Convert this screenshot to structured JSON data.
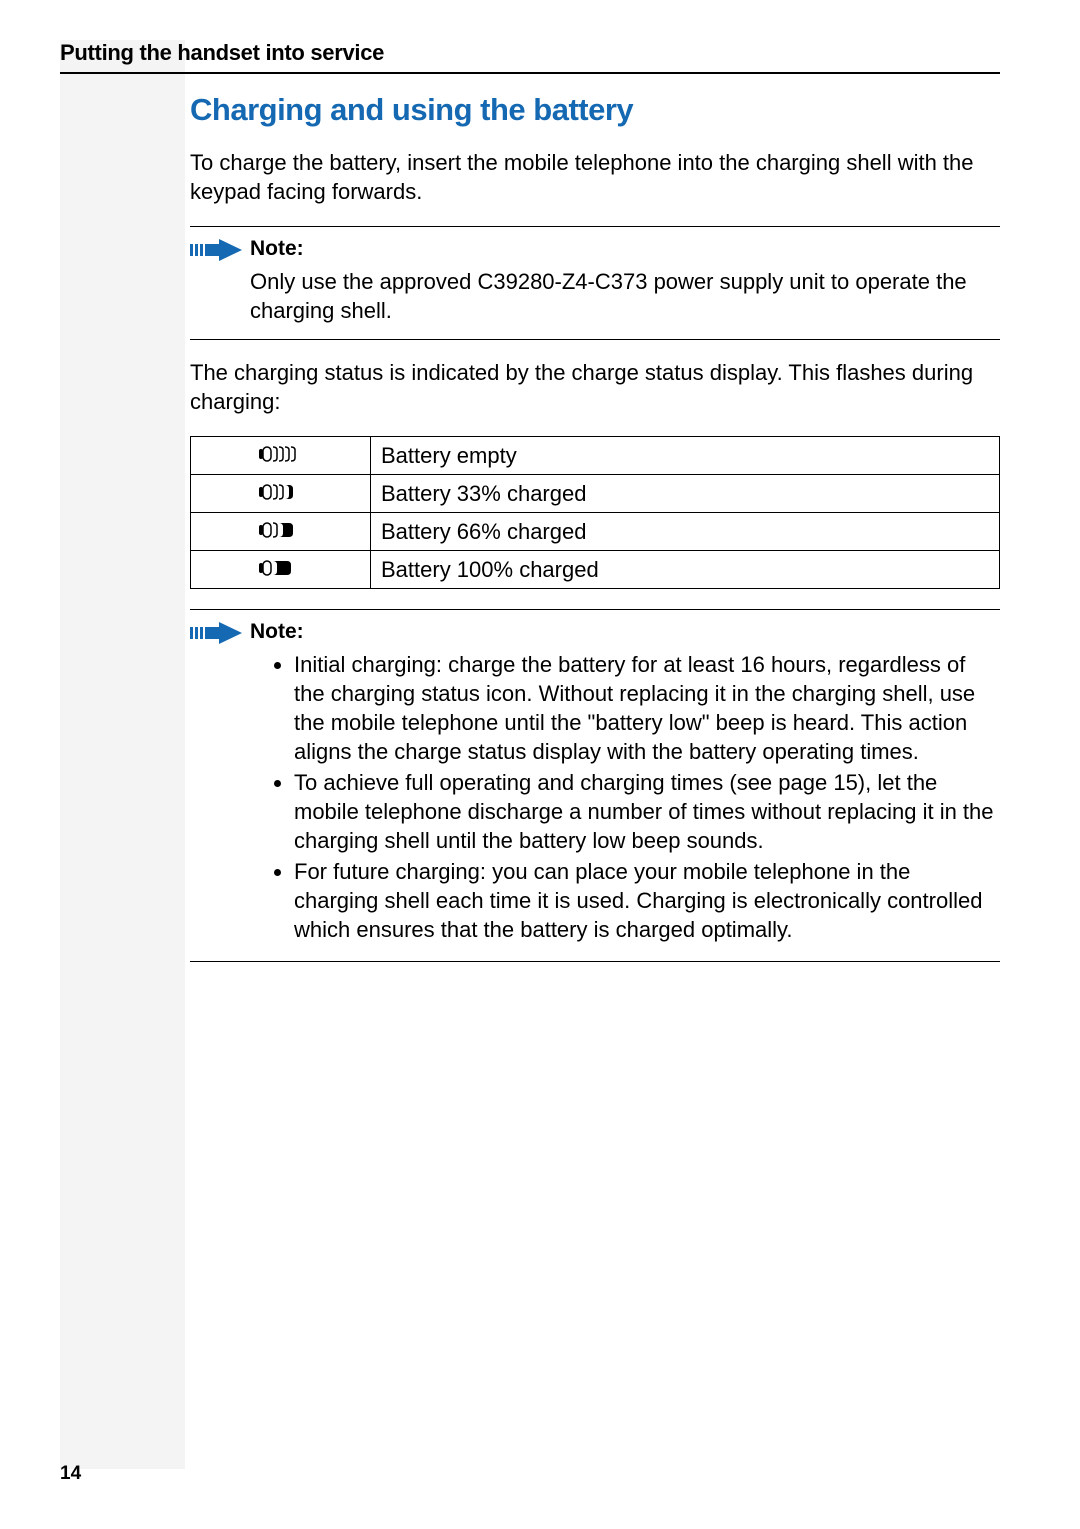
{
  "header": {
    "section_title": "Putting the handset into service"
  },
  "page_number": "14",
  "section": {
    "heading": "Charging and using the battery",
    "intro": "To charge the battery, insert the mobile telephone into the charging shell with the keypad facing forwards.",
    "note1_label": "Note:",
    "note1_text": "Only use the approved C39280-Z4-C373 power supply unit to operate the charging shell.",
    "status_intro": "The charging status is indicated by the charge status display. This flashes during charging:",
    "table": {
      "rows": [
        {
          "icon": "battery-empty-icon",
          "label": "Battery empty"
        },
        {
          "icon": "battery-33-icon",
          "label": "Battery 33% charged"
        },
        {
          "icon": "battery-66-icon",
          "label": "Battery 66% charged"
        },
        {
          "icon": "battery-100-icon",
          "label": "Battery 100% charged"
        }
      ]
    },
    "note2_label": "Note:",
    "note2_bullets": [
      "Initial charging: charge the battery for at least 16 hours, regardless of the charging status icon. Without replacing it in the charging shell, use the mobile telephone until the \"battery low\" beep is heard. This action aligns the charge status display with the battery operating times.",
      "To achieve full operating and charging times (see page 15), let the mobile telephone discharge a number of times without replacing it in the charging shell until the battery low beep sounds.",
      "For future charging: you can place your mobile telephone in the charging shell each time it is used. Charging is electronically controlled which ensures that the battery is charged optimally."
    ]
  }
}
